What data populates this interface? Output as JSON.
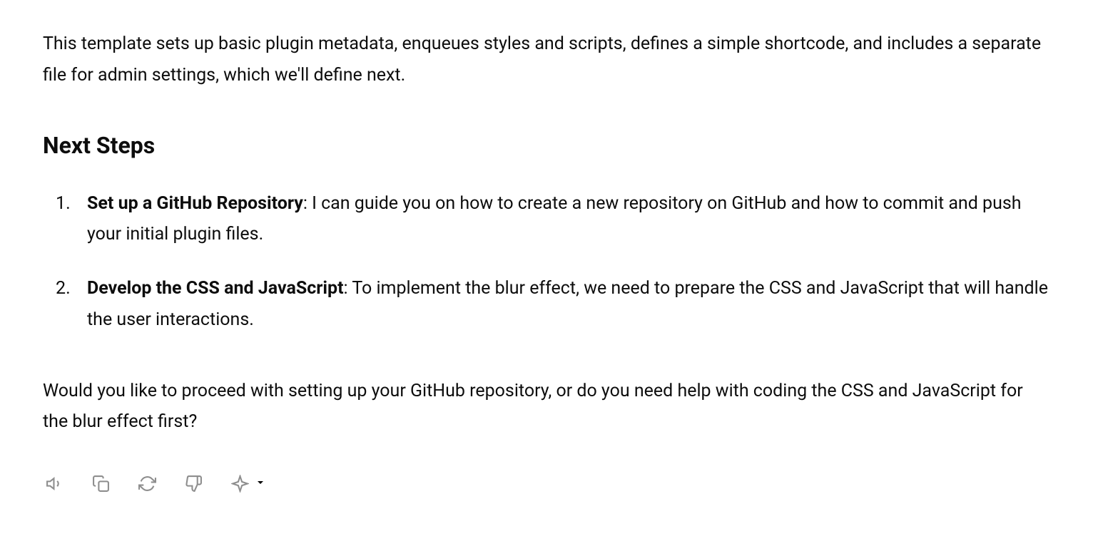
{
  "intro": "This template sets up basic plugin metadata, enqueues styles and scripts, defines a simple shortcode, and includes a separate file for admin settings, which we'll define next.",
  "heading": "Next Steps",
  "steps": [
    {
      "title": "Set up a GitHub Repository",
      "body": ": I can guide you on how to create a new repository on GitHub and how to commit and push your initial plugin files."
    },
    {
      "title": "Develop the CSS and JavaScript",
      "body": ": To implement the blur effect, we need to prepare the CSS and JavaScript that will handle the user interactions."
    }
  ],
  "closing": "Would you like to proceed with setting up your GitHub repository, or do you need help with coding the CSS and JavaScript for the blur effect first?"
}
